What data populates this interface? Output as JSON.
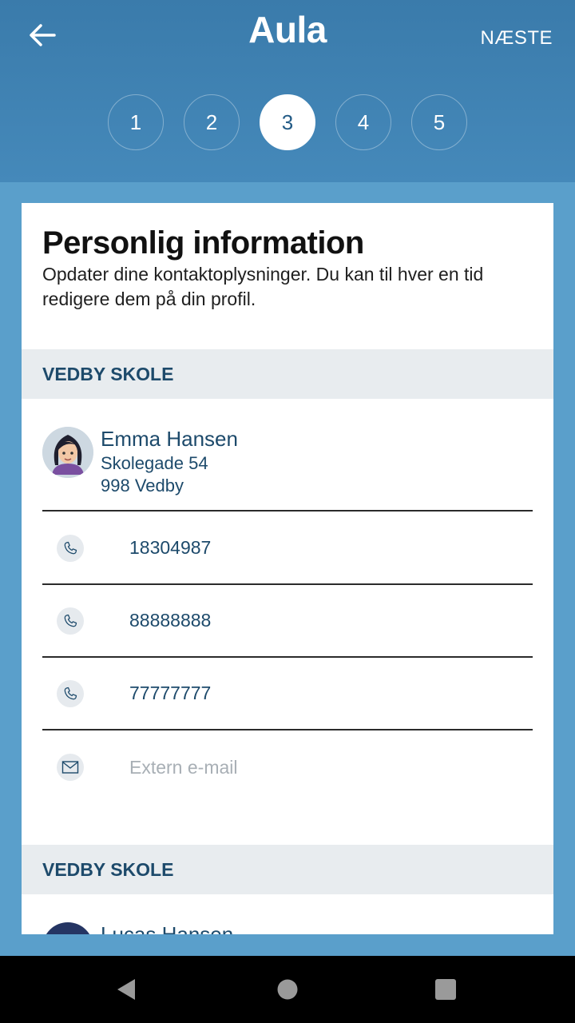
{
  "app": {
    "logo": "Aula",
    "next_label": "NÆSTE"
  },
  "steps": [
    "1",
    "2",
    "3",
    "4",
    "5"
  ],
  "active_step": 3,
  "card": {
    "title": "Personlig information",
    "description": "Opdater dine kontaktoplysninger. Du kan til hver en tid redigere dem på din profil."
  },
  "sections": [
    {
      "school": "VEDBY SKOLE",
      "person": {
        "name": "Emma Hansen",
        "address_line1": "Skolegade 54",
        "address_line2": "998 Vedby"
      },
      "phones": [
        "18304987",
        "88888888",
        "77777777"
      ],
      "email": {
        "value": "",
        "placeholder": "Extern e-mail"
      }
    },
    {
      "school": "VEDBY SKOLE",
      "person": {
        "name": "Lucas Hansen"
      }
    }
  ],
  "icons": {
    "back": "arrow-left-icon",
    "phone": "phone-icon",
    "email": "envelope-icon",
    "nav_back": "triangle-back-icon",
    "nav_home": "circle-home-icon",
    "nav_recent": "square-recent-icon"
  },
  "colors": {
    "header": "#3a7bab",
    "background": "#5a9fcb",
    "text_primary": "#1d4a6b",
    "section_bg": "#e8ecef"
  }
}
